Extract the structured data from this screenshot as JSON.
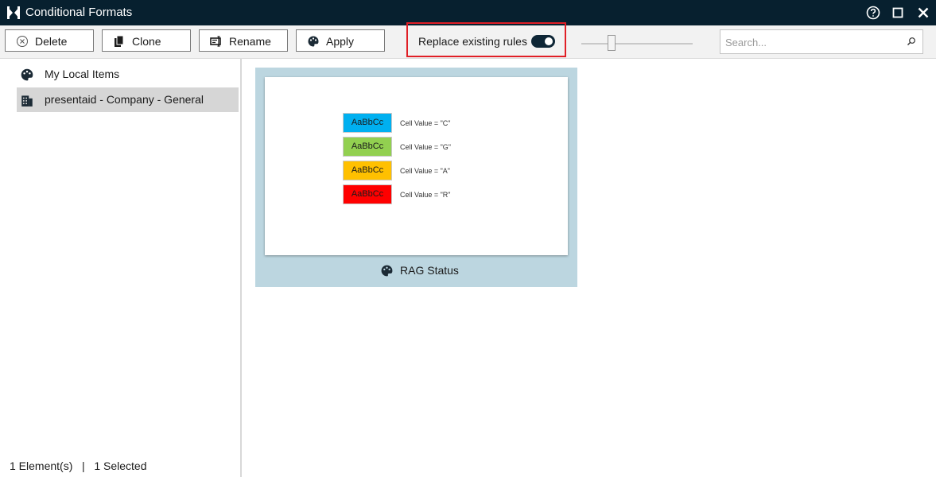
{
  "window": {
    "title": "Conditional Formats"
  },
  "toolbar": {
    "delete_label": "Delete",
    "clone_label": "Clone",
    "rename_label": "Rename",
    "apply_label": "Apply",
    "replace_label": "Replace existing rules",
    "replace_toggle_on": true,
    "size_slider_fraction": 0.25
  },
  "search": {
    "placeholder": "Search..."
  },
  "sidebar": {
    "items": [
      {
        "label": "My Local Items",
        "icon": "palette-icon"
      },
      {
        "label": "presentaid - Company - General",
        "icon": "building-icon"
      }
    ]
  },
  "status": {
    "text": "1 Element(s)   |   1 Selected"
  },
  "tile": {
    "name": "RAG Status",
    "rules": [
      {
        "swatch_text": "AaBbCc",
        "rule": "Cell Value = \"C\"",
        "color": "#00b0f0"
      },
      {
        "swatch_text": "AaBbCc",
        "rule": "Cell Value = \"G\"",
        "color": "#92d050"
      },
      {
        "swatch_text": "AaBbCc",
        "rule": "Cell Value = \"A\"",
        "color": "#ffc000"
      },
      {
        "swatch_text": "AaBbCc",
        "rule": "Cell Value = \"R\"",
        "color": "#ff0000"
      }
    ]
  },
  "colors": {
    "titlebar": "#07202f",
    "highlight_border": "#e01f26",
    "tile_background": "#bcd6e0",
    "selected_item": "#d6d6d6"
  }
}
